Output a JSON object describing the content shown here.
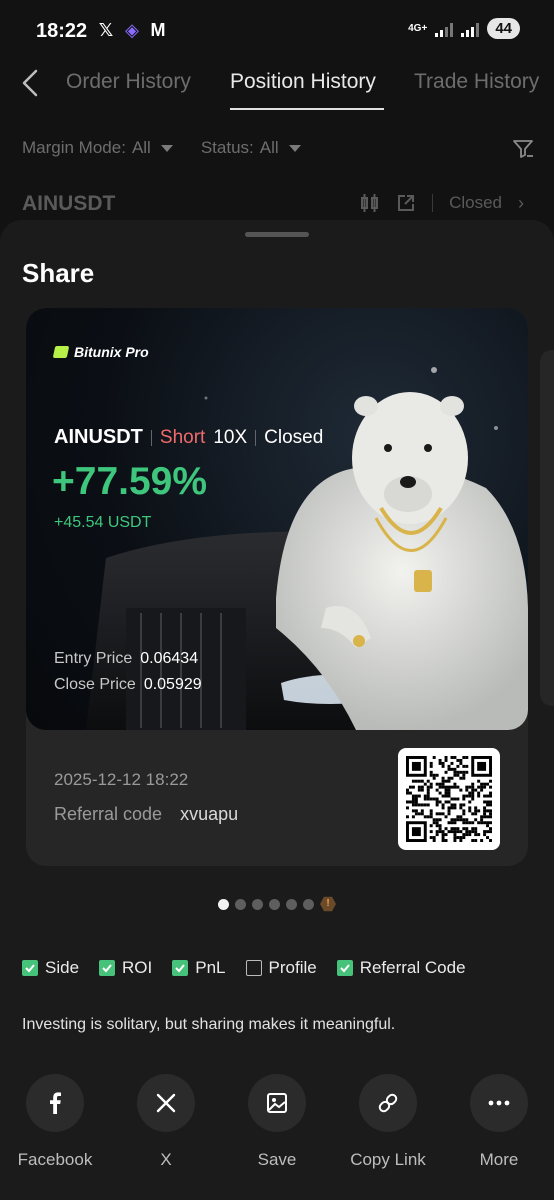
{
  "status_bar": {
    "time": "18:22",
    "network": "4G+",
    "battery": "44"
  },
  "nav": {
    "tabs": [
      {
        "label": "Order History"
      },
      {
        "label": "Position History"
      },
      {
        "label": "Trade History"
      }
    ],
    "active_tab": "Position History"
  },
  "filters": {
    "margin_mode_label": "Margin Mode:",
    "margin_mode_value": "All",
    "status_label": "Status:",
    "status_value": "All"
  },
  "position_row": {
    "symbol": "AINUSDT",
    "status": "Closed"
  },
  "sheet": {
    "title": "Share",
    "card": {
      "brand": "Bitunix Pro",
      "symbol": "AINUSDT",
      "side": "Short",
      "leverage": "10X",
      "status": "Closed",
      "roi": "+77.59%",
      "pnl": "+45.54 USDT",
      "entry_price_label": "Entry Price",
      "entry_price": "0.06434",
      "close_price_label": "Close Price",
      "close_price": "0.05929",
      "timestamp": "2025-12-12 18:22",
      "referral_label": "Referral code",
      "referral_code": "xvuapu"
    },
    "pagination": {
      "count": 6,
      "active_index": 0,
      "badge": "!"
    },
    "options": [
      {
        "label": "Side",
        "checked": true
      },
      {
        "label": "ROI",
        "checked": true
      },
      {
        "label": "PnL",
        "checked": true
      },
      {
        "label": "Profile",
        "checked": false
      },
      {
        "label": "Referral Code",
        "checked": true
      }
    ],
    "tagline": "Investing is solitary, but sharing makes it meaningful.",
    "actions": [
      {
        "label": "Facebook",
        "icon": "facebook-icon"
      },
      {
        "label": "X",
        "icon": "x-icon"
      },
      {
        "label": "Save",
        "icon": "image-icon"
      },
      {
        "label": "Copy Link",
        "icon": "link-icon"
      },
      {
        "label": "More",
        "icon": "more-icon"
      }
    ]
  },
  "colors": {
    "profit": "#3fc67d",
    "short": "#f06a6a",
    "checkbox": "#47c27a",
    "brand_accent": "#b8f04a"
  }
}
